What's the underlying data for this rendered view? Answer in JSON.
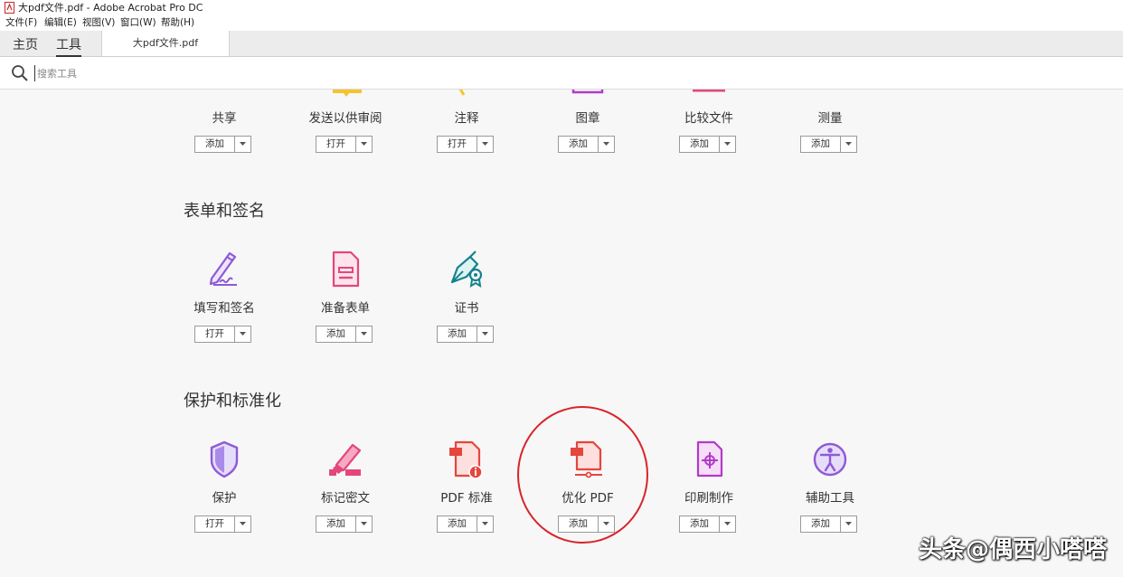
{
  "window": {
    "title": "大pdf文件.pdf - Adobe Acrobat Pro DC"
  },
  "menu": [
    "文件(F)",
    "编辑(E)",
    "视图(V)",
    "窗口(W)",
    "帮助(H)"
  ],
  "tabs": {
    "home": "主页",
    "tools": "工具",
    "document": "大pdf文件.pdf"
  },
  "search": {
    "placeholder": "搜索工具"
  },
  "sections": [
    {
      "title": "",
      "tools": [
        {
          "name": "共享",
          "button": "添加"
        },
        {
          "name": "发送以供审阅",
          "button": "打开"
        },
        {
          "name": "注释",
          "button": "打开"
        },
        {
          "name": "图章",
          "button": "添加"
        },
        {
          "name": "比较文件",
          "button": "添加"
        },
        {
          "name": "测量",
          "button": "添加"
        }
      ]
    },
    {
      "title": "表单和签名",
      "tools": [
        {
          "name": "填写和签名",
          "button": "打开",
          "icon": "fill-sign-icon"
        },
        {
          "name": "准备表单",
          "button": "添加",
          "icon": "prepare-form-icon"
        },
        {
          "name": "证书",
          "button": "添加",
          "icon": "certificate-icon"
        }
      ]
    },
    {
      "title": "保护和标准化",
      "tools": [
        {
          "name": "保护",
          "button": "打开",
          "icon": "shield-icon"
        },
        {
          "name": "标记密文",
          "button": "添加",
          "icon": "redact-icon"
        },
        {
          "name": "PDF 标准",
          "button": "添加",
          "icon": "pdf-standard-icon"
        },
        {
          "name": "优化 PDF",
          "button": "添加",
          "icon": "optimize-pdf-icon"
        },
        {
          "name": "印刷制作",
          "button": "添加",
          "icon": "print-production-icon"
        },
        {
          "name": "辅助工具",
          "button": "添加",
          "icon": "accessibility-icon"
        }
      ]
    }
  ],
  "watermark": "头条@偶西小嗒嗒",
  "colors": {
    "purple": "#8e5ad6",
    "pink": "#e4477a",
    "red": "#e5463d",
    "teal": "#15838c",
    "magenta": "#b23bc7",
    "highlight": "#d9242b"
  }
}
